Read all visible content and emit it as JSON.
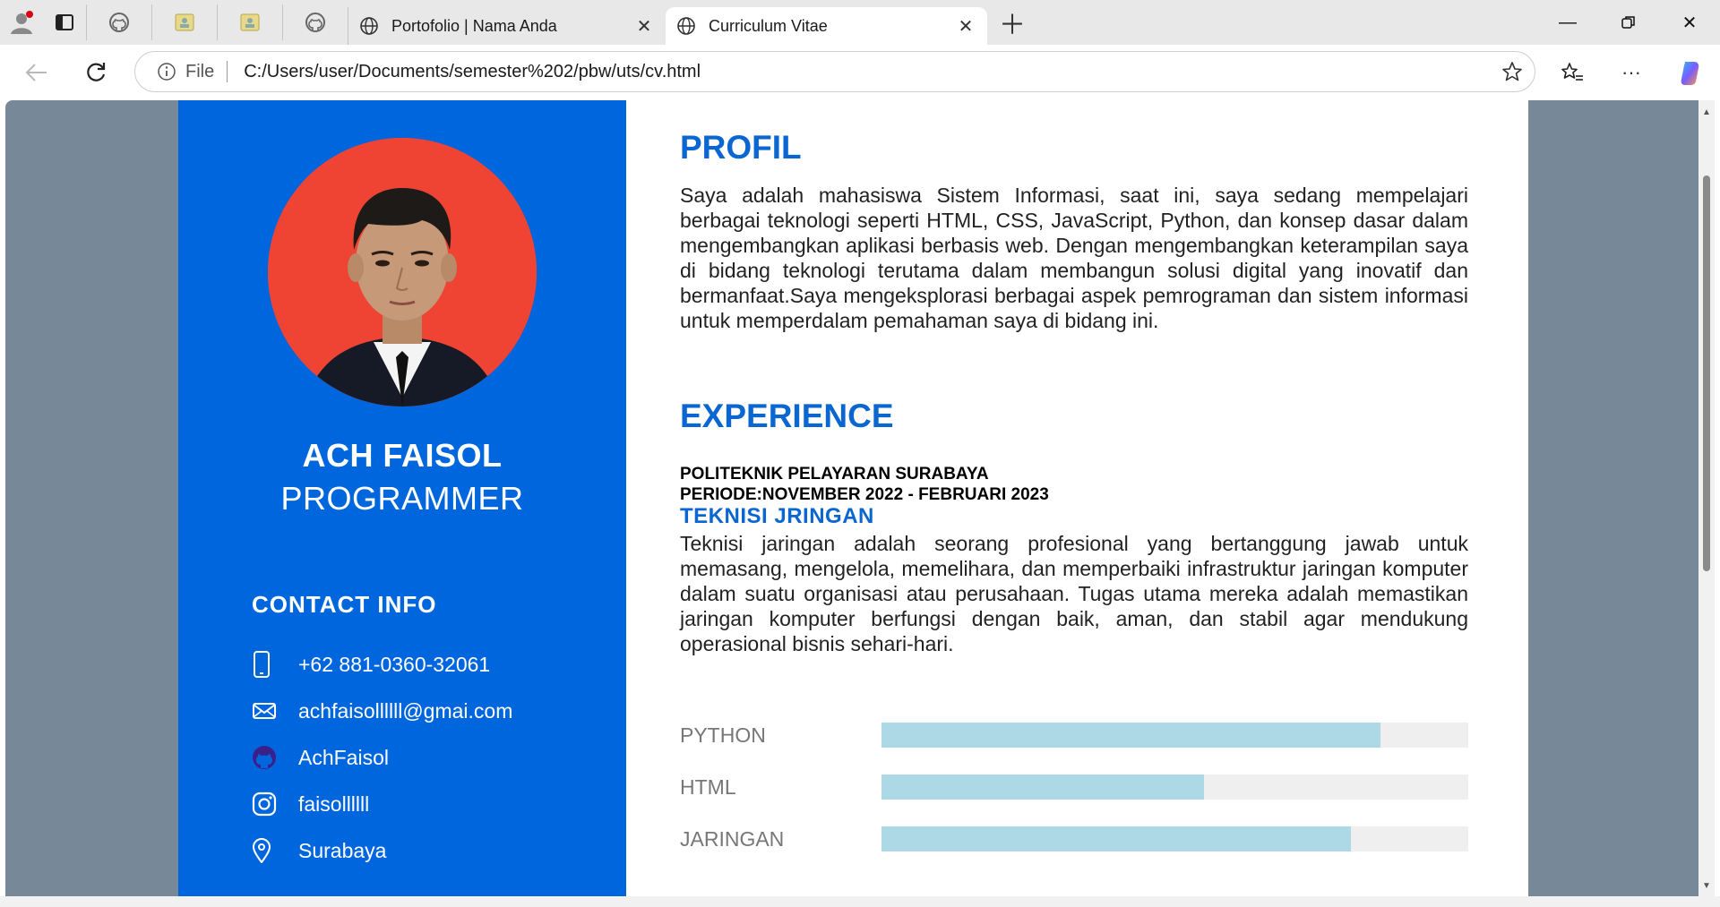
{
  "browser": {
    "tabs": [
      {
        "title": "Portofolio | Nama Anda",
        "active": false
      },
      {
        "title": "Curriculum Vitae",
        "active": true
      }
    ],
    "address": {
      "scheme_label": "File",
      "url": "C:/Users/user/Documents/semester%202/pbw/uts/cv.html"
    }
  },
  "cv": {
    "name": "ACH FAISOL",
    "role": "PROGRAMMER",
    "contact_title": "CONTACT INFO",
    "contacts": [
      {
        "icon": "phone-icon",
        "text": "+62 881-0360-32061"
      },
      {
        "icon": "mail-icon",
        "text": "achfaisollllll@gmai.com"
      },
      {
        "icon": "github-icon",
        "text": "AchFaisol"
      },
      {
        "icon": "instagram-icon",
        "text": "faisollllll"
      },
      {
        "icon": "location-pin-icon",
        "text": "Surabaya"
      }
    ],
    "profile": {
      "title": "PROFIL",
      "text": "Saya adalah mahasiswa Sistem Informasi, saat ini, saya sedang mempelajari berbagai teknologi seperti HTML, CSS, JavaScript, Python, dan konsep dasar dalam mengembangkan aplikasi berbasis web. Dengan mengembangkan keterampilan saya di bidang teknologi terutama dalam membangun solusi digital yang inovatif dan bermanfaat.Saya mengeksplorasi berbagai aspek pemrograman dan sistem informasi untuk memperdalam pemahaman saya di bidang ini."
    },
    "experience": {
      "title": "EXPERIENCE",
      "org": "POLITEKNIK PELAYARAN SURABAYA",
      "period": "PERIODE:NOVEMBER 2022 - FEBRUARI 2023",
      "job": "TEKNISI JRINGAN",
      "description": "Teknisi jaringan adalah seorang profesional yang bertanggung jawab untuk memasang, mengelola, memelihara, dan memperbaiki infrastruktur jaringan komputer dalam suatu organisasi atau perusahaan. Tugas utama mereka adalah memastikan jaringan komputer berfungsi dengan baik, aman, dan stabil agar mendukung operasional bisnis sehari-hari."
    },
    "skills": [
      {
        "name": "PYTHON",
        "level": 0.85
      },
      {
        "name": "HTML",
        "level": 0.55
      },
      {
        "name": "JARINGAN",
        "level": 0.8
      }
    ]
  },
  "colors": {
    "sidebar": "#0066dd",
    "accent": "#0a66d0",
    "skill_fill": "#add8e6",
    "page_bg": "#778899"
  }
}
